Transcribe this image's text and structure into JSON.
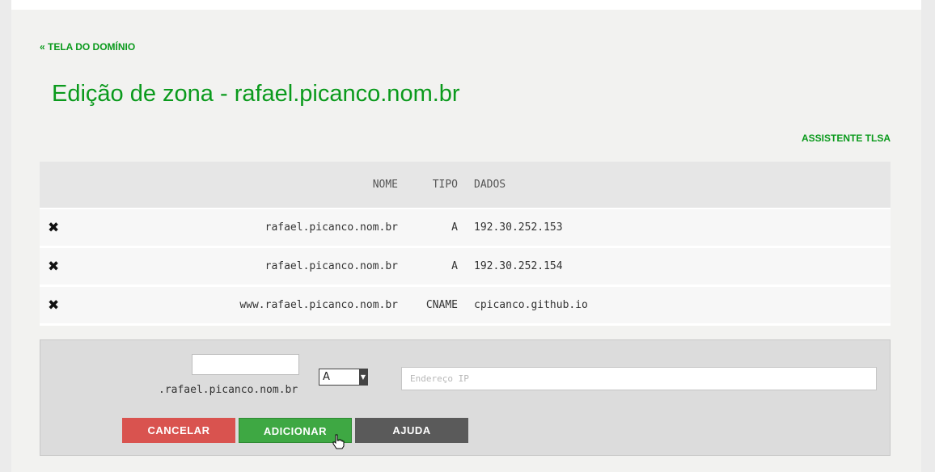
{
  "nav": {
    "back_label": "« TELA DO DOMÍNIO",
    "tlsa_label": "ASSISTENTE TLSA"
  },
  "page": {
    "title": "Edição de zona - rafael.picanco.nom.br"
  },
  "table": {
    "headers": {
      "name": "NOME",
      "type": "TIPO",
      "data": "DADOS"
    },
    "rows": [
      {
        "name": "rafael.picanco.nom.br",
        "type": "A",
        "data": "192.30.252.153"
      },
      {
        "name": "rafael.picanco.nom.br",
        "type": "A",
        "data": "192.30.252.154"
      },
      {
        "name": "www.rafael.picanco.nom.br",
        "type": "CNAME",
        "data": "cpicanco.github.io"
      }
    ],
    "delete_icon": "✖"
  },
  "form": {
    "name_value": "",
    "domain_suffix": ".rafael.picanco.nom.br",
    "type_selected": "A",
    "data_placeholder": "Endereço IP",
    "cancel_label": "CANCELAR",
    "add_label": "ADICIONAR",
    "help_label": "AJUDA"
  }
}
